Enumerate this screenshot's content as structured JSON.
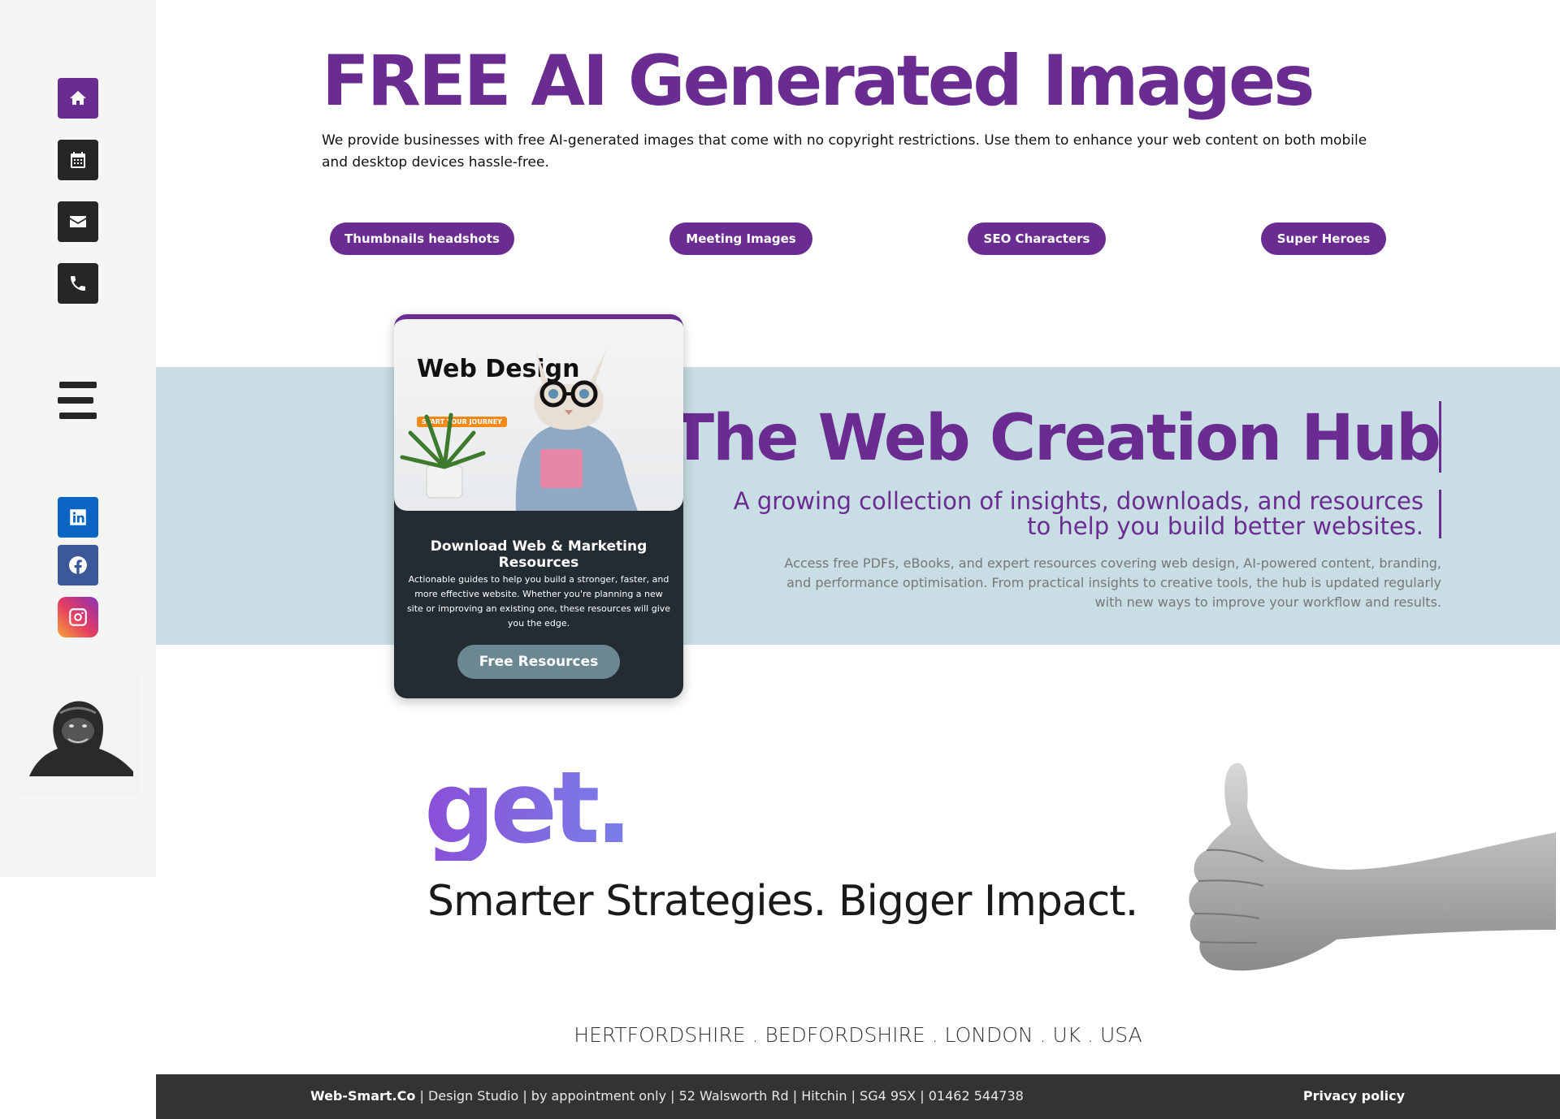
{
  "header": {
    "title": "FREE AI Generated Images",
    "intro": "We provide businesses with free AI-generated images that come with no copyright restrictions. Use them to enhance your web content on both mobile and desktop devices hassle-free."
  },
  "categories": [
    {
      "label": "Thumbnails headshots"
    },
    {
      "label": "Meeting Images"
    },
    {
      "label": "SEO Characters"
    },
    {
      "label": "Super Heroes"
    }
  ],
  "sidebar": {
    "icons": [
      "home-icon",
      "calendar-icon",
      "mail-icon",
      "phone-icon",
      "menu-icon"
    ],
    "social": [
      "linkedin-icon",
      "facebook-icon",
      "instagram-icon"
    ]
  },
  "card": {
    "image_title": "Web Design",
    "image_tag": "START YOUR JOURNEY",
    "heading": "Download Web & Marketing Resources",
    "text": "Actionable guides to help you build a stronger, faster, and more effective website. Whether you're planning a new site or improving an existing one, these resources will give you the edge.",
    "button": "Free Resources"
  },
  "hub": {
    "title": "The Web Creation Hub",
    "subtitle": "A growing collection of insights, downloads, and resources to help you build better websites.",
    "description": "Access free PDFs, eBooks, and expert resources covering web design, AI-powered content, branding, and performance optimisation. From practical insights to creative tools, the hub is updated regularly with new ways to improve your workflow and results."
  },
  "promo": {
    "word": "get.",
    "tagline": "Smarter Strategies. Bigger Impact."
  },
  "regions": "HERTFORDSHIRE . BEDFORDSHIRE . LONDON . UK . USA",
  "footer": {
    "brand": "Web-Smart.Co",
    "details": " | Design Studio | by appointment only | 52 Walsworth Rd | Hitchin | SG4 9SX | 01462 544738",
    "privacy": "Privacy policy"
  },
  "colors": {
    "brand_purple": "#6a2c91",
    "hub_band": "#c8dde4",
    "footer_bg": "#333333",
    "card_bg": "#232b33"
  }
}
